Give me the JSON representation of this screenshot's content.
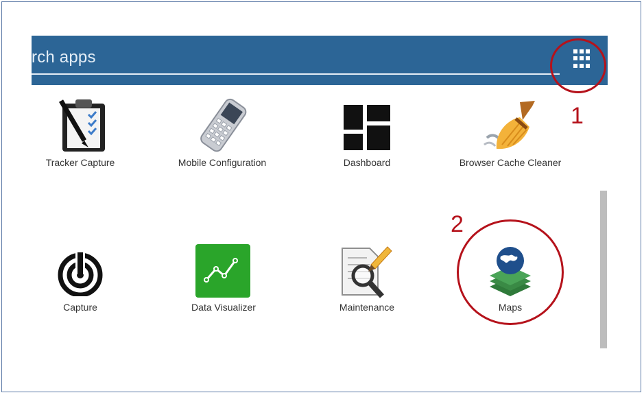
{
  "search": {
    "placeholder_visible": "rch apps"
  },
  "apps": [
    {
      "label": "Tracker Capture",
      "icon": "clipboard-icon"
    },
    {
      "label": "Mobile Configuration",
      "icon": "phone-icon"
    },
    {
      "label": "Dashboard",
      "icon": "dashboard-grid-icon"
    },
    {
      "label": "Browser Cache Cleaner",
      "icon": "broom-icon"
    },
    {
      "label": "Capture",
      "icon": "capture-icon"
    },
    {
      "label": "Data Visualizer",
      "icon": "chart-line-icon"
    },
    {
      "label": "Maintenance",
      "icon": "document-magnifier-icon"
    },
    {
      "label": "Maps",
      "icon": "maps-globe-icon"
    }
  ],
  "annotations": {
    "marker_1": "1",
    "marker_2": "2"
  },
  "colors": {
    "header": "#2c6596",
    "annotation": "#b5121b",
    "data_visualizer": "#2aa52a",
    "maps_globe": "#1f4f8c",
    "maps_layers": "#3a8a45"
  }
}
